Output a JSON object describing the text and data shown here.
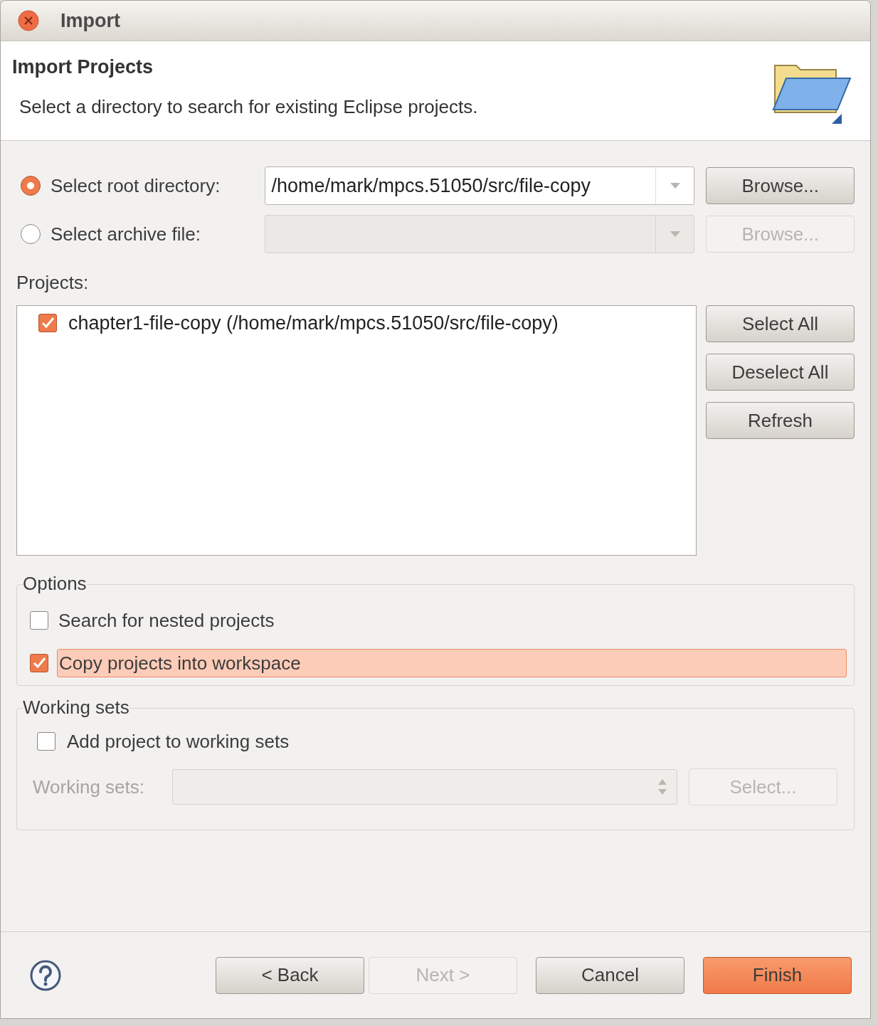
{
  "window": {
    "title": "Import"
  },
  "header": {
    "title": "Import Projects",
    "description": "Select a directory to search for existing Eclipse projects."
  },
  "sources": [
    {
      "label": "Select root directory:",
      "selected": true,
      "value": "/home/mark/mpcs.51050/src/file-copy",
      "disabled": false,
      "browse": {
        "label": "Browse...",
        "disabled": false
      }
    },
    {
      "label": "Select archive file:",
      "selected": false,
      "disabled": true,
      "browse": {
        "label": "Browse...",
        "disabled": true
      }
    }
  ],
  "projects": {
    "label": "Projects:",
    "items": [
      {
        "label": "chapter1-file-copy (/home/mark/mpcs.51050/src/file-copy)",
        "checked": true
      }
    ],
    "buttons": [
      "Select All",
      "Deselect All",
      "Refresh"
    ]
  },
  "options": {
    "title": "Options",
    "items": [
      {
        "label": "Search for nested projects",
        "checked": false,
        "focused": false
      },
      {
        "label": "Copy projects into workspace",
        "checked": true,
        "focused": true
      }
    ]
  },
  "working_sets": {
    "title": "Working sets",
    "checkbox": {
      "label": "Add project to working sets",
      "checked": false
    },
    "field": {
      "label": "Working sets:",
      "disabled": true
    },
    "select": {
      "label": "Select...",
      "disabled": true
    }
  },
  "footer": {
    "buttons": [
      {
        "label": "< Back",
        "disabled": false,
        "default": false
      },
      {
        "label": "Next >",
        "disabled": true,
        "default": false
      },
      {
        "label": "Cancel",
        "disabled": false,
        "default": false
      },
      {
        "label": "Finish",
        "disabled": false,
        "default": true
      }
    ]
  }
}
